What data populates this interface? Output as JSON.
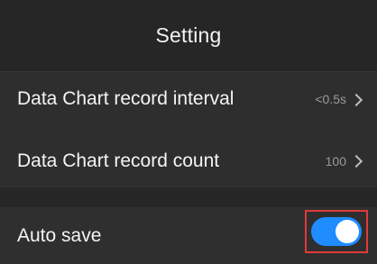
{
  "header": {
    "title": "Setting"
  },
  "settings": {
    "rows": [
      {
        "label": "Data Chart record interval",
        "value": "<0.5s"
      },
      {
        "label": "Data Chart record count",
        "value": "100"
      }
    ],
    "auto_save": {
      "label": "Auto save",
      "enabled": true,
      "accent_color": "#1f8cff"
    }
  },
  "highlight_color": "#e23a3a",
  "icons": {
    "row_chevron": "chevron-right-icon",
    "toggle": "toggle-switch-icon"
  }
}
